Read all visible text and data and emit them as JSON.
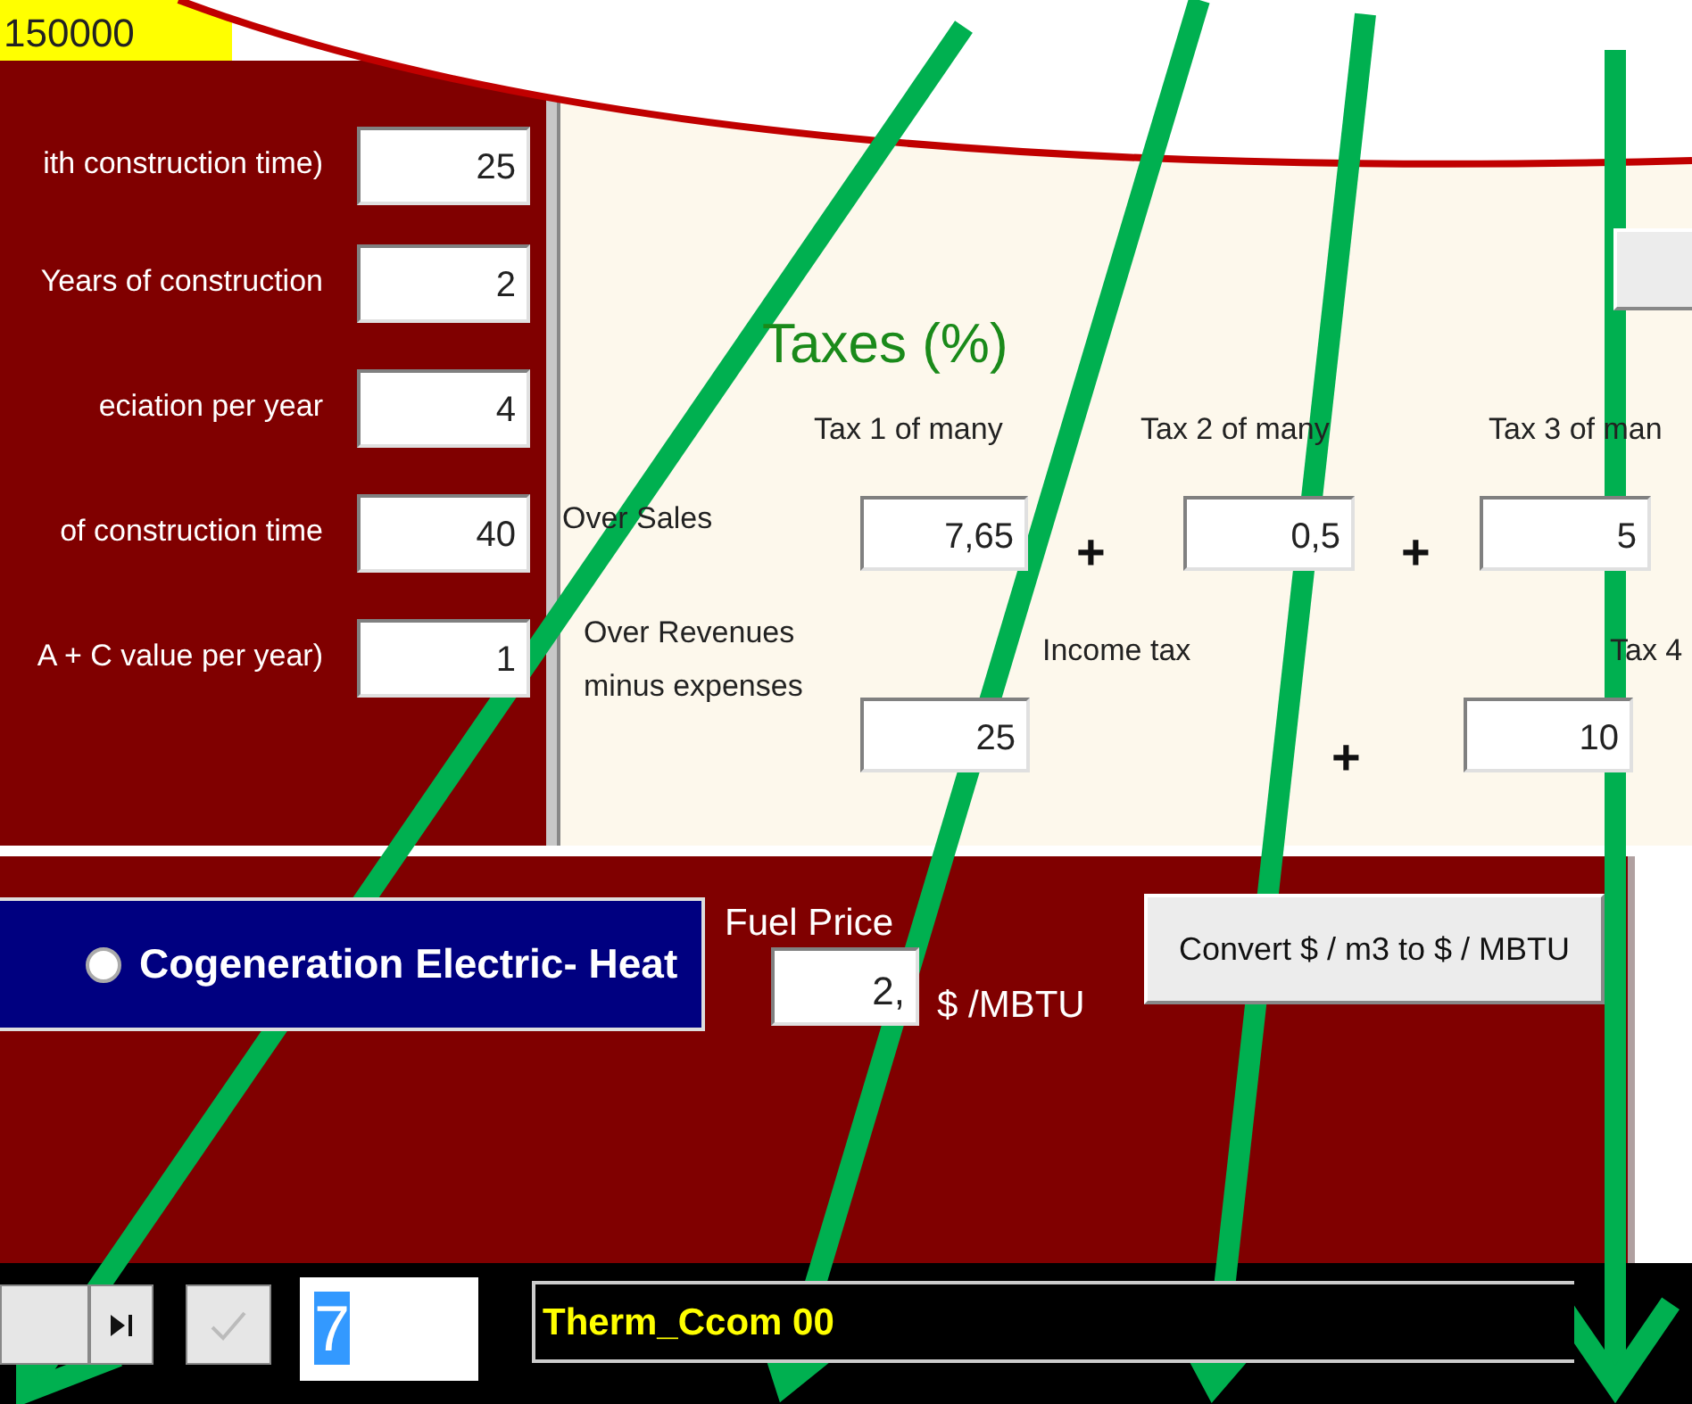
{
  "top_field": {
    "value": "150000"
  },
  "parameters": [
    {
      "label": "ith construction time)",
      "value": "25"
    },
    {
      "label": "Years of construction",
      "value": "2"
    },
    {
      "label": "eciation per year",
      "value": "4"
    },
    {
      "label": "of construction time",
      "value": "40"
    },
    {
      "label": "A + C value per year)",
      "value": "1"
    }
  ],
  "taxes": {
    "title": "Taxes (%)",
    "columns": [
      "Tax 1 of many",
      "Tax 2 of many",
      "Tax 3 of man"
    ],
    "sales": {
      "label": "Over Sales",
      "values": [
        "7,65",
        "0,5",
        "5"
      ]
    },
    "revenues": {
      "label": "Over Revenues minus expenses",
      "income_tax_label": "Income tax",
      "tax4_label": "Tax 4",
      "values": [
        "25",
        "10"
      ]
    },
    "plus": "+"
  },
  "mode": {
    "label": "Cogeneration Electric- Heat",
    "selected": false
  },
  "fuel": {
    "label": "Fuel Price",
    "value": "2,",
    "unit": "$ /MBTU"
  },
  "convert_button": "Convert $ / m3 to $ / MBTU",
  "navigator": {
    "record": "7",
    "save_disabled": true
  },
  "status": "Therm_Ccom 00"
}
